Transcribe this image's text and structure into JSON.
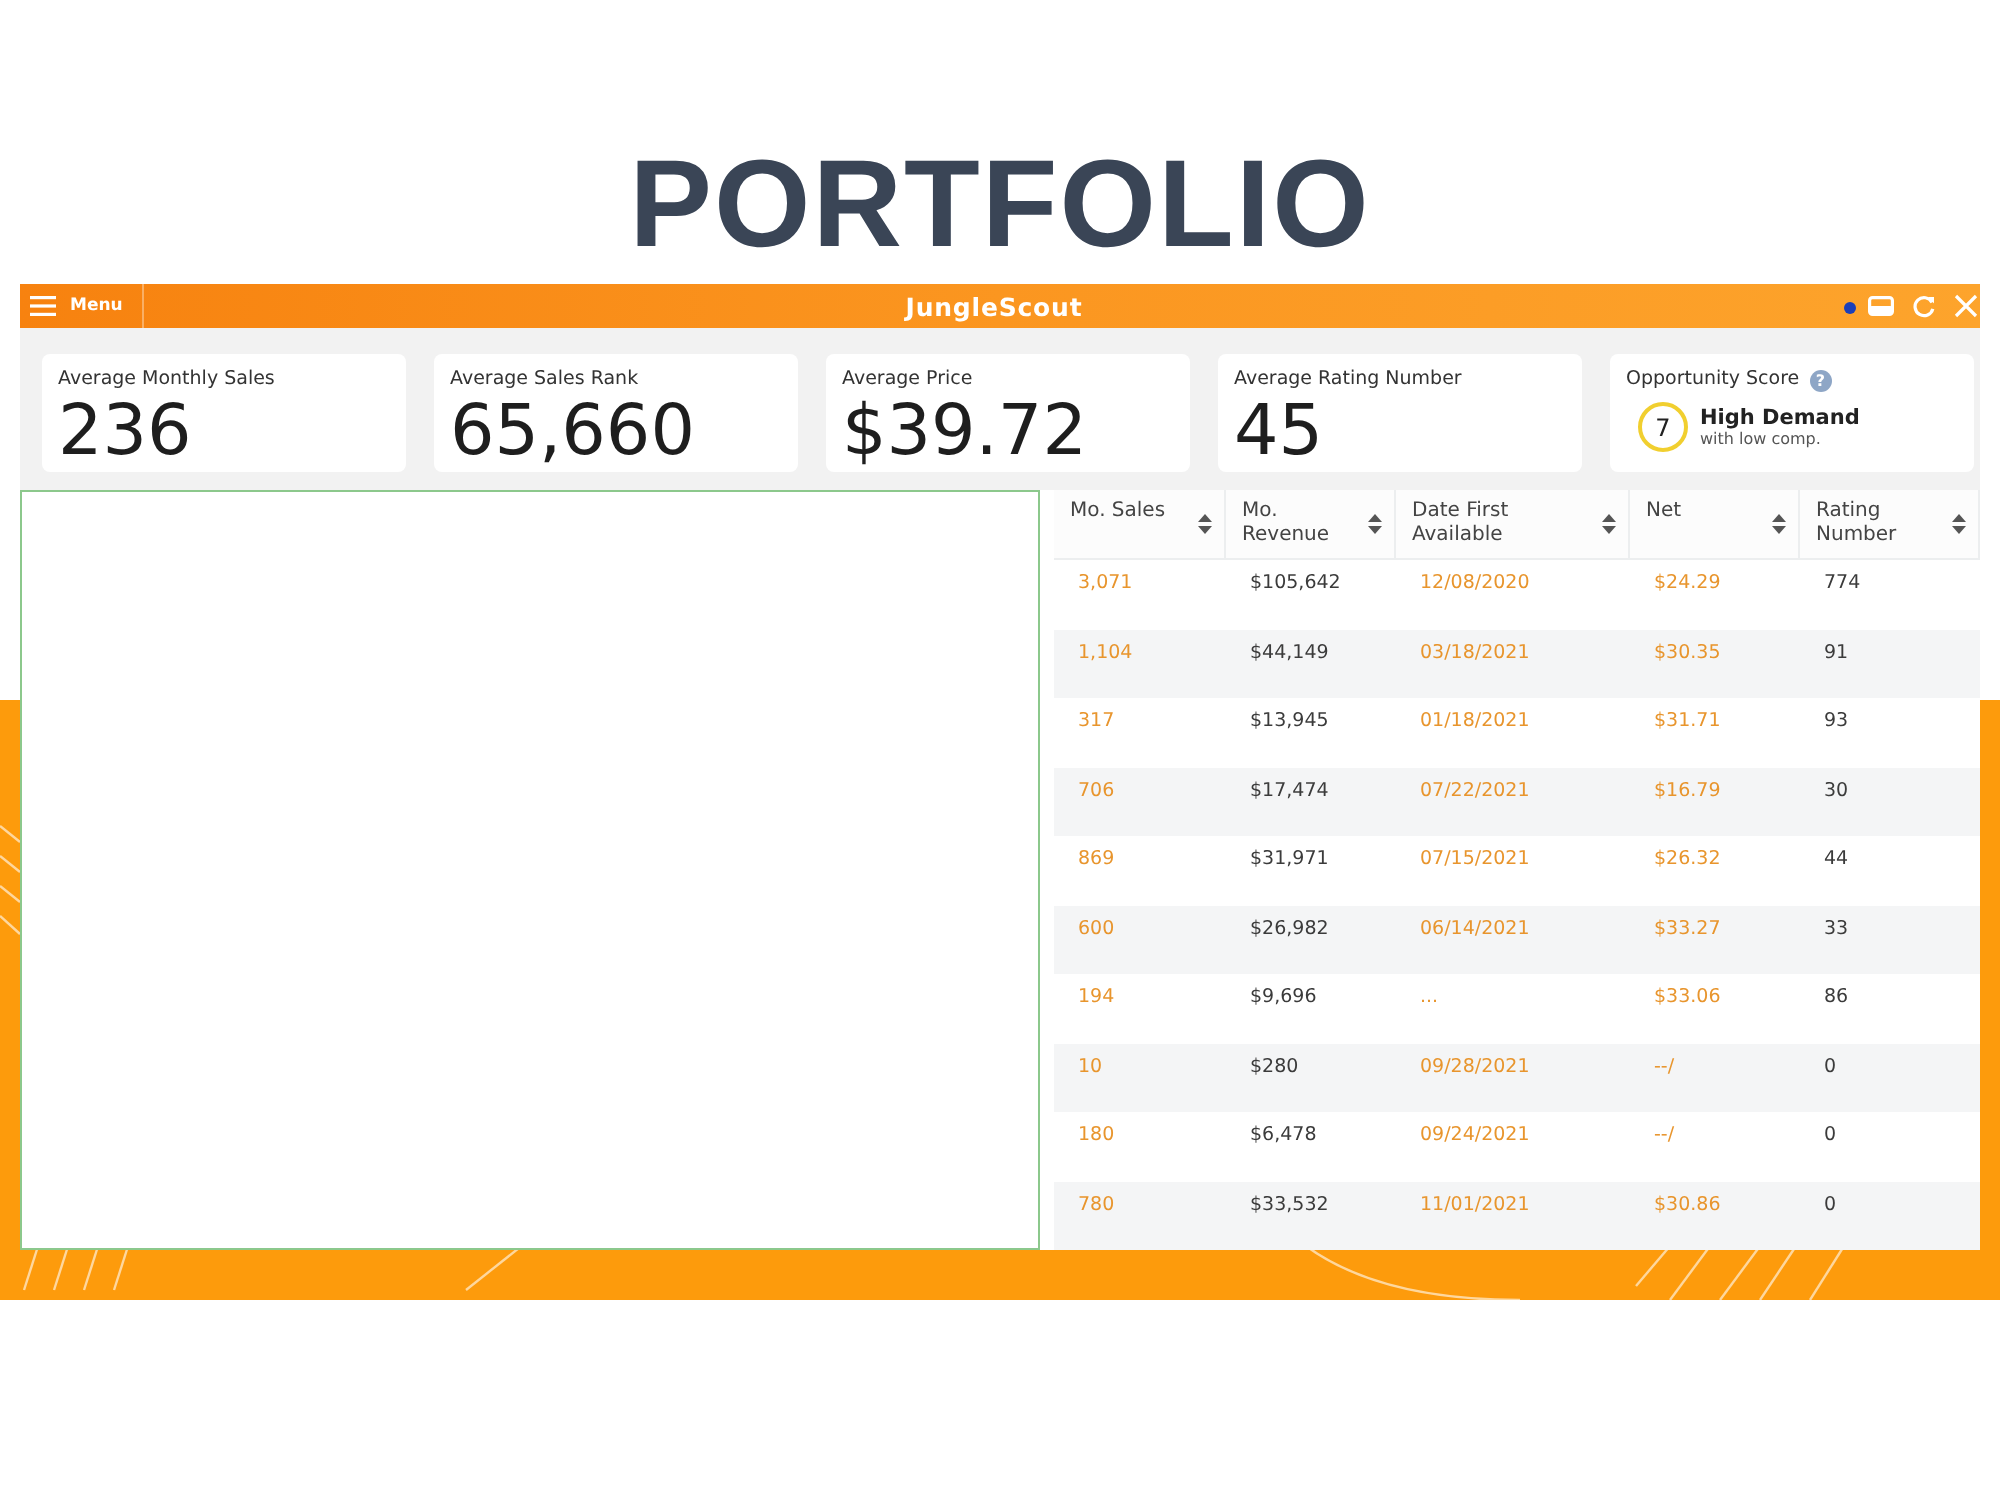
{
  "page_title": "PORTFOLIO",
  "app_bar": {
    "menu_label": "Menu",
    "title": "JungleScout"
  },
  "stats": [
    {
      "kind": "value",
      "label": "Average Monthly Sales",
      "value": "236"
    },
    {
      "kind": "value",
      "label": "Average Sales Rank",
      "value": "65,660"
    },
    {
      "kind": "value",
      "label": "Average Price",
      "value": "$39.72"
    },
    {
      "kind": "value",
      "label": "Average Rating Number",
      "value": "45"
    },
    {
      "kind": "score",
      "label": "Opportunity Score",
      "help": "?",
      "score": "7",
      "headline": "High Demand",
      "note": "with low comp."
    }
  ],
  "table": {
    "columns": [
      {
        "label": "Mo. Sales",
        "kind": "highlight"
      },
      {
        "label": "Mo. Revenue",
        "kind": "plain"
      },
      {
        "label": "Date First Available",
        "kind": "highlight"
      },
      {
        "label": "Net",
        "kind": "highlight"
      },
      {
        "label": "Rating Number",
        "kind": "plain"
      }
    ],
    "rows": [
      [
        "3,071",
        "$105,642",
        "12/08/2020",
        "$24.29",
        "774"
      ],
      [
        "1,104",
        "$44,149",
        "03/18/2021",
        "$30.35",
        "91"
      ],
      [
        "317",
        "$13,945",
        "01/18/2021",
        "$31.71",
        "93"
      ],
      [
        "706",
        "$17,474",
        "07/22/2021",
        "$16.79",
        "30"
      ],
      [
        "869",
        "$31,971",
        "07/15/2021",
        "$26.32",
        "44"
      ],
      [
        "600",
        "$26,982",
        "06/14/2021",
        "$33.27",
        "33"
      ],
      [
        "194",
        "$9,696",
        "...",
        "$33.06",
        "86"
      ],
      [
        "10",
        "$280",
        "09/28/2021",
        "--/",
        "0"
      ],
      [
        "180",
        "$6,478",
        "09/24/2021",
        "--/",
        "0"
      ],
      [
        "780",
        "$33,532",
        "11/01/2021",
        "$30.86",
        "0"
      ]
    ]
  }
}
